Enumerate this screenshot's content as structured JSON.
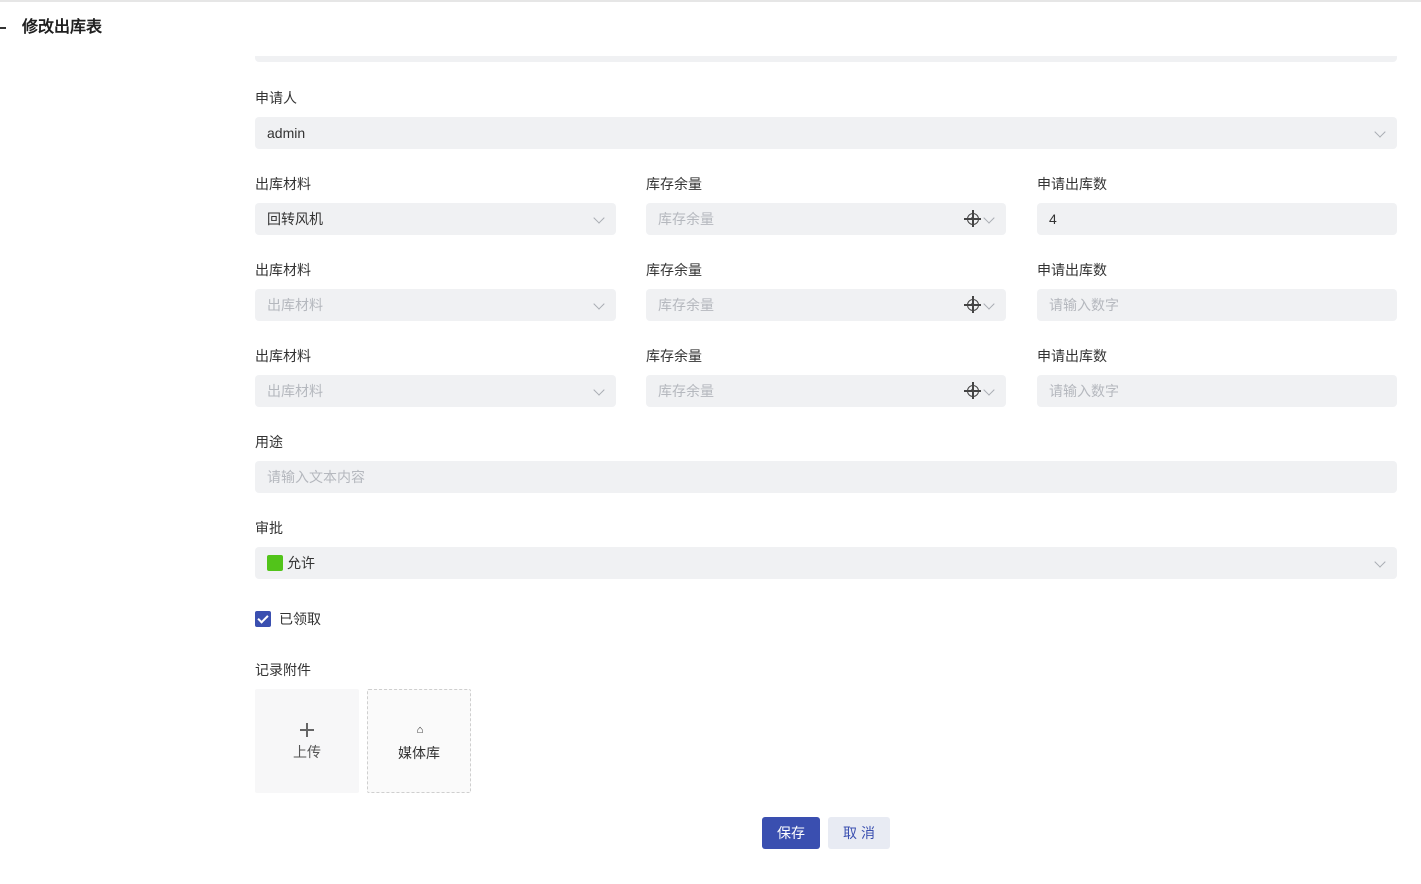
{
  "page": {
    "title": "修改出库表"
  },
  "applicant": {
    "label": "申请人",
    "value": "admin"
  },
  "material_rows": [
    {
      "material_label": "出库材料",
      "material_value": "回转风机",
      "material_placeholder": "出库材料",
      "stock_label": "库存余量",
      "stock_placeholder": "库存余量",
      "qty_label": "申请出库数",
      "qty_value": "4",
      "qty_placeholder": "请输入数字"
    },
    {
      "material_label": "出库材料",
      "material_value": "",
      "material_placeholder": "出库材料",
      "stock_label": "库存余量",
      "stock_placeholder": "库存余量",
      "qty_label": "申请出库数",
      "qty_value": "",
      "qty_placeholder": "请输入数字"
    },
    {
      "material_label": "出库材料",
      "material_value": "",
      "material_placeholder": "出库材料",
      "stock_label": "库存余量",
      "stock_placeholder": "库存余量",
      "qty_label": "申请出库数",
      "qty_value": "",
      "qty_placeholder": "请输入数字"
    }
  ],
  "purpose": {
    "label": "用途",
    "placeholder": "请输入文本内容"
  },
  "approval": {
    "label": "审批",
    "value": "允许",
    "color": "#52c41a"
  },
  "received": {
    "label": "已领取",
    "checked": true
  },
  "attachments": {
    "label": "记录附件",
    "upload_label": "上传",
    "media_label": "媒体库",
    "upload_icon": "plus-icon",
    "media_icon": "home-icon"
  },
  "actions": {
    "save_label": "保存",
    "cancel_label": "取消"
  },
  "colors": {
    "primary": "#3a4fb0",
    "field_bg": "#f0f1f3"
  }
}
